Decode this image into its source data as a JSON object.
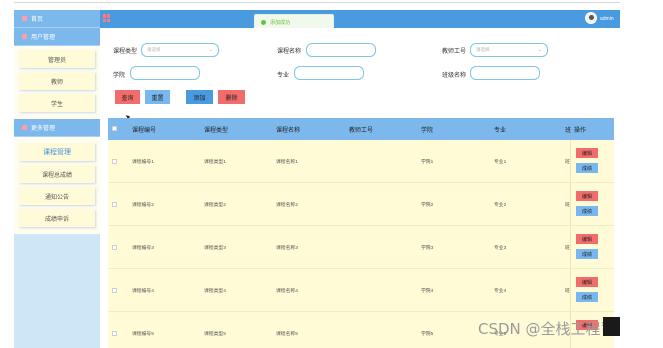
{
  "sidebar": {
    "home": "首页",
    "user_mgmt": "用户管理",
    "user_items": [
      "管理员",
      "教师",
      "学生"
    ],
    "more_mgmt": "更多管理",
    "more_items": [
      "课程管理",
      "课程总成绩",
      "通知公告",
      "成绩申诉"
    ]
  },
  "topbar": {
    "admin": "admin"
  },
  "toast": {
    "text": "添加成功"
  },
  "search": {
    "course_type_label": "课程类型",
    "course_type_placeholder": "请选择",
    "course_name_label": "课程名称",
    "teacher_no_label": "教师工号",
    "teacher_no_placeholder": "请选择",
    "college_label": "学院",
    "major_label": "专业",
    "class_label": "班级名称",
    "query_btn": "查询",
    "reset_btn": "重置",
    "add_btn": "添加",
    "delete_btn": "删除"
  },
  "table": {
    "headers": [
      "课程编号",
      "课程类型",
      "课程名称",
      "教师工号",
      "学院",
      "专业",
      "班",
      "操作"
    ],
    "rows": [
      [
        "课程编号1",
        "课程类型1",
        "课程名称1",
        "",
        "学院1",
        "专业1",
        "班"
      ],
      [
        "课程编号2",
        "课程类型2",
        "课程名称2",
        "",
        "学院2",
        "专业2",
        "班"
      ],
      [
        "课程编号3",
        "课程类型3",
        "课程名称3",
        "",
        "学院3",
        "专业3",
        "班"
      ],
      [
        "课程编号4",
        "课程类型4",
        "课程名称4",
        "",
        "学院4",
        "专业4",
        "班"
      ],
      [
        "课程编号5",
        "课程类型5",
        "课程名称5",
        "",
        "学院5",
        "专业5",
        ""
      ]
    ],
    "edit_btn": "编辑",
    "score_btn": "成绩"
  },
  "watermark": "CSDN @全栈工程司"
}
